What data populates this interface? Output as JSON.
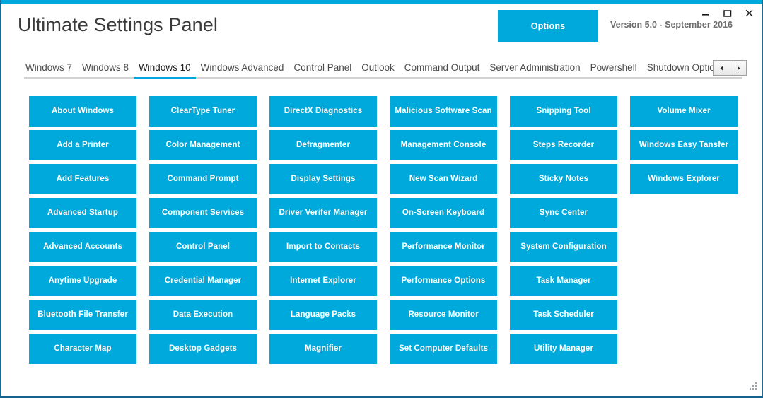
{
  "window": {
    "title": "Ultimate Settings Panel",
    "controls": [
      {
        "name": "minimize",
        "label": "–"
      },
      {
        "name": "maximize",
        "label": "☐"
      },
      {
        "name": "close",
        "label": "✕"
      }
    ],
    "accent_color": "#00a9dc",
    "border_color": "#15628f"
  },
  "header": {
    "title": "Ultimate Settings Panel",
    "options_label": "Options",
    "version": "Version 5.0 - September 2016"
  },
  "tabs": {
    "items": [
      {
        "label": "Windows 7",
        "active": false
      },
      {
        "label": "Windows 8",
        "active": false
      },
      {
        "label": "Windows 10",
        "active": true
      },
      {
        "label": "Windows Advanced",
        "active": false
      },
      {
        "label": "Control Panel",
        "active": false
      },
      {
        "label": "Outlook",
        "active": false
      },
      {
        "label": "Command Output",
        "active": false
      },
      {
        "label": "Server Administration",
        "active": false
      },
      {
        "label": "Powershell",
        "active": false
      },
      {
        "label": "Shutdown Options",
        "active": false
      }
    ],
    "truncated_label": "I",
    "scroll_left_label": "◀",
    "scroll_right_label": "▶",
    "active_underline_color": "#00a9dc",
    "inactive_underline_color": "#d2d2d2"
  },
  "grid": {
    "columns": [
      {
        "buttons": [
          "About Windows",
          "Add a Printer",
          "Add Features",
          "Advanced Startup",
          "Advanced Accounts",
          "Anytime Upgrade",
          "Bluetooth File Transfer",
          "Character Map"
        ]
      },
      {
        "buttons": [
          "ClearType Tuner",
          "Color Management",
          "Command Prompt",
          "Component Services",
          "Control Panel",
          "Credential Manager",
          "Data Execution",
          "Desktop Gadgets"
        ]
      },
      {
        "buttons": [
          "DirectX Diagnostics",
          "Defragmenter",
          "Display Settings",
          "Driver Verifer Manager",
          "Import to Contacts",
          "Internet Explorer",
          "Language Packs",
          "Magnifier"
        ]
      },
      {
        "buttons": [
          "Malicious Software Scan",
          "Management Console",
          "New Scan Wizard",
          "On-Screen Keyboard",
          "Performance Monitor",
          "Performance Options",
          "Resource Monitor",
          "Set Computer Defaults"
        ]
      },
      {
        "buttons": [
          "Snipping Tool",
          "Steps Recorder",
          "Sticky Notes",
          "Sync Center",
          "System Configuration",
          "Task Manager",
          "Task Scheduler",
          "Utility Manager"
        ]
      },
      {
        "buttons": [
          "Volume Mixer",
          "Windows Easy Tansfer",
          "Windows Explorer"
        ]
      }
    ]
  }
}
